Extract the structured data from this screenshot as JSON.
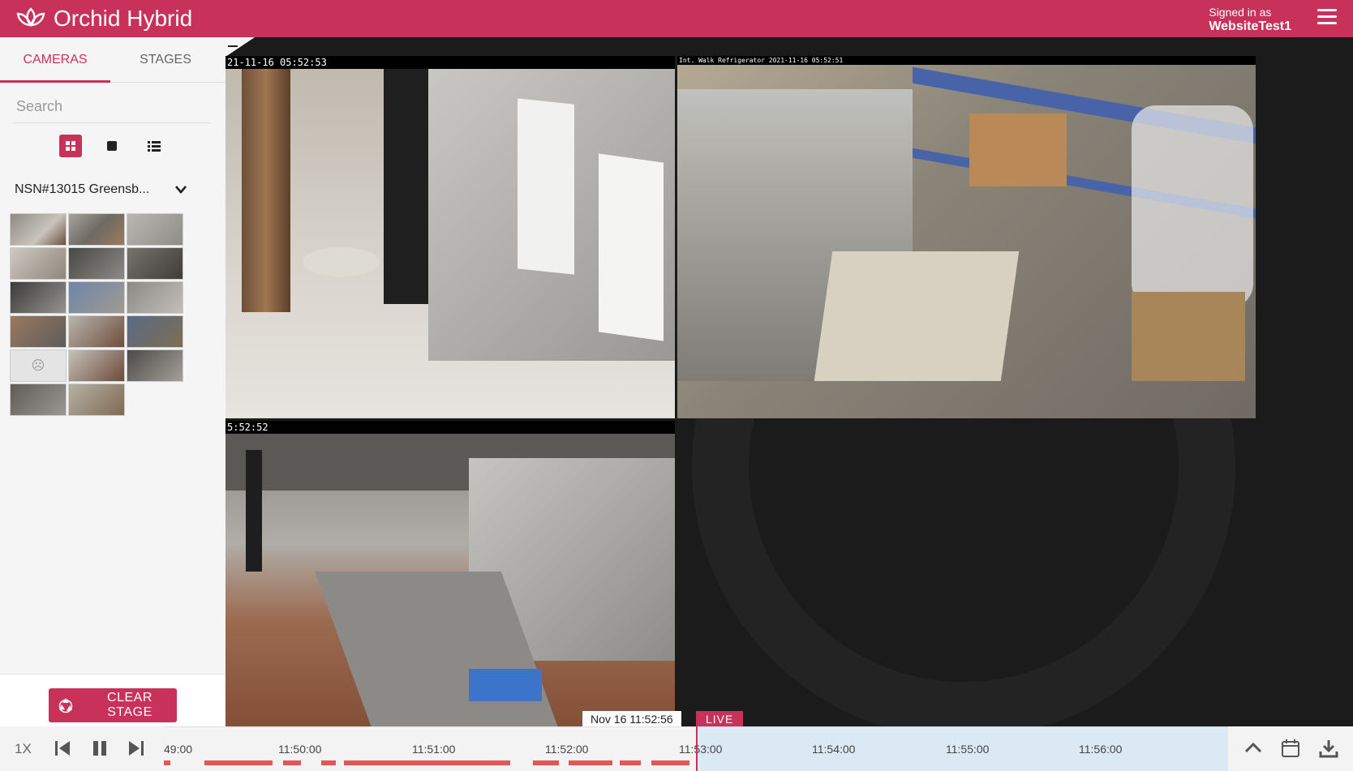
{
  "app": {
    "title": "Orchid Hybrid"
  },
  "user": {
    "signed_in_label": "Signed in as",
    "name": "WebsiteTest1"
  },
  "sidebar": {
    "tabs": [
      {
        "label": "CAMERAS",
        "active": true
      },
      {
        "label": "STAGES",
        "active": false
      }
    ],
    "search": {
      "placeholder": "Search",
      "value": ""
    },
    "site": {
      "label": "NSN#13015 Greensb..."
    },
    "clear_label": "CLEAR STAGE"
  },
  "cameras": [
    {
      "header": "21-11-16 05:52:53"
    },
    {
      "header": "Int. Walk Refrigerator 2021-11-16 05:52:51"
    },
    {
      "header": "5:52:52"
    }
  ],
  "timeline": {
    "speed": "1X",
    "ticks": [
      "49:00",
      "11:50:00",
      "11:51:00",
      "11:52:00",
      "11:53:00",
      "11:54:00",
      "11:55:00",
      "11:56:00"
    ],
    "current": "Nov 16 11:52:56",
    "live_label": "LIVE"
  },
  "colors": {
    "accent": "#c8325a",
    "recording": "#e05757",
    "live_zone": "#dbe9f4"
  }
}
